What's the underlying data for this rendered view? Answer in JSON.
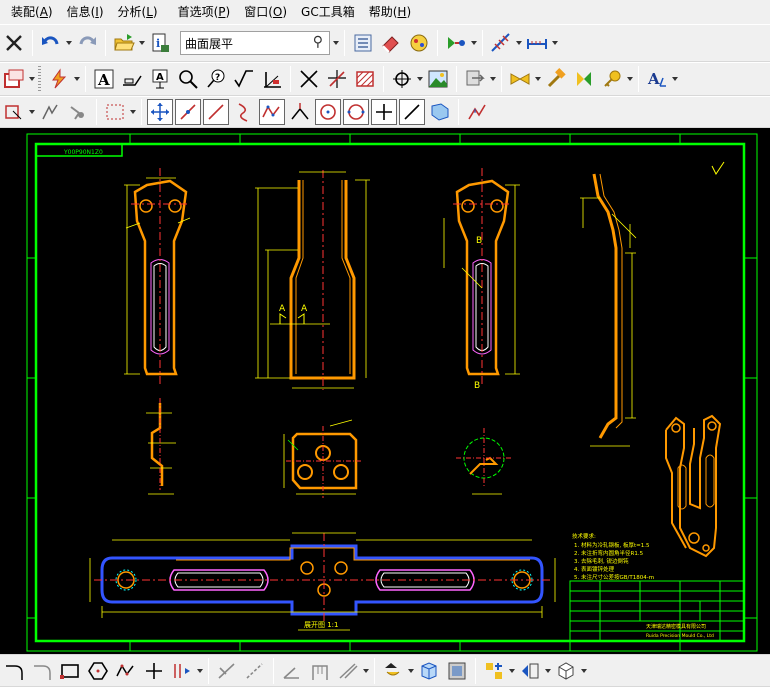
{
  "menu": [
    {
      "label": "装配(A)"
    },
    {
      "label": "信息(I)"
    },
    {
      "label": "分析(L)"
    },
    {
      "label": "首选项(P)"
    },
    {
      "label": "窗口(O)"
    },
    {
      "label": "GC工具箱"
    },
    {
      "label": "帮助(H)"
    }
  ],
  "toolbar": {
    "command_search_value": "曲面展平"
  },
  "drawing": {
    "sheet_label": "Y00P90N1Z0",
    "section_a_label": "A",
    "section_b_label": "B",
    "flat_view_label": "展开图 1:1",
    "tech_title": "技术要求:",
    "tech_notes": [
      "1. 材料为冷轧钢板, 板厚t=1.5",
      "2. 未注折弯内圆角半径R1.5",
      "3. 去除毛刺, 锐边倒钝",
      "4. 表面镀锌处理",
      "5. 未注尺寸公差按GB/T1804-m"
    ],
    "company_cn": "天津瑞达精密模具有限公司",
    "company_en": "Ruida Precision Mould Co., Ltd",
    "colors": {
      "background": "#000000",
      "border": "#00ff00",
      "part": "#ff9900",
      "dimension": "#ffff00",
      "centerline": "#ff3333",
      "flat_outline": "#3355ff",
      "hidden": "#ff66ff"
    }
  },
  "icons": {
    "toolbar1": [
      "close-icon",
      "undo-icon",
      "redo-icon",
      "open-folder-icon",
      "info-icon",
      "layer-list-icon",
      "eraser-icon",
      "pattern-icon",
      "arrow-vector-icon",
      "dimension-grid-icon",
      "measure-icon"
    ],
    "toolbar2": [
      "part-view-icon",
      "snap-lightning-icon",
      "text-annotation-icon",
      "leader-icon",
      "info-text-icon",
      "zoom-icon",
      "help-icon",
      "sqrt-icon",
      "datum-icon",
      "cross-icon",
      "intersect-icon",
      "hatch-icon",
      "target-icon",
      "image-icon",
      "replace-icon",
      "bow-tie-icon",
      "hammer-icon",
      "pin-icon",
      "key-icon",
      "text-style-icon"
    ],
    "toolbar3": [
      "select-filter-icon",
      "snap-icon",
      "snap-point-icon",
      "box-select-icon",
      "move-icon",
      "line-point-icon",
      "curve-icon",
      "polyline-icon",
      "angle-icon",
      "circle-center-icon",
      "circle-icon",
      "plus-icon",
      "slash-icon",
      "view-icon",
      "vector-icon"
    ],
    "bottom": [
      "arc-icon",
      "fillet-icon",
      "rectangle-icon",
      "hexagon-icon",
      "polyline-icon",
      "plus-icon",
      "offset-icon",
      "trim-icon",
      "extend-icon",
      "chamfer-icon",
      "bracket-icon",
      "dim-icon",
      "mirror-icon",
      "cube-icon",
      "layer-icon",
      "tool-icon",
      "assembly-icon",
      "shade-icon"
    ]
  }
}
